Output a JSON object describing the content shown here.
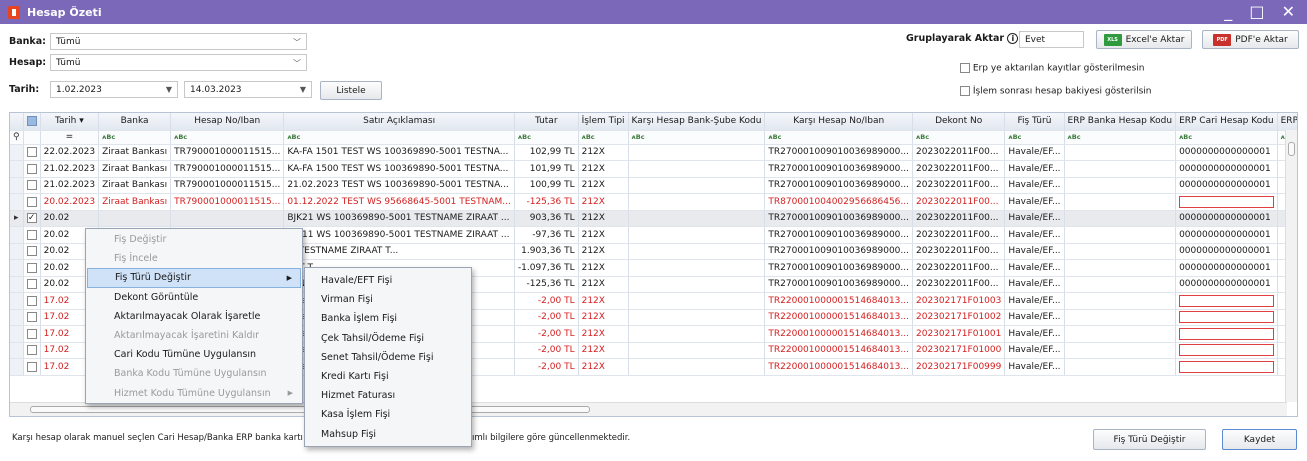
{
  "window": {
    "title": "Hesap Özeti",
    "controls": "_ □ ✕"
  },
  "filters": {
    "banka_label": "Banka:",
    "banka_value": "Tümü",
    "hesap_label": "Hesap:",
    "hesap_value": "Tümü",
    "tarih_label": "Tarih:",
    "tarih_from": "1.02.2023",
    "tarih_to": "14.03.2023",
    "list_button": "Listele"
  },
  "toolbar": {
    "group_label": "Gruplayarak Aktar",
    "info": "i",
    "group_value": "Evet",
    "excel_button": "Excel'e Aktar",
    "excel_tag": "XLS",
    "pdf_button": "PDF'e Aktar",
    "pdf_tag": "PDF"
  },
  "options": {
    "erp_hidden": "Erp ye aktarılan kayıtlar gösterilmesin",
    "balance_shown": "İşlem sonrası hesap bakiyesi gösterilsin"
  },
  "columns": [
    "",
    "Tarih",
    "Banka",
    "Hesap No/Iban",
    "Satır Açıklaması",
    "Tutar",
    "İşlem Tipi",
    "Karşı Hesap Bank-Şube Kodu",
    "Karşı Hesap No/Iban",
    "Dekont No",
    "Fiş Türü",
    "ERP Banka Hesap Kodu",
    "ERP Cari Hesap Kodu",
    "ERP"
  ],
  "filter_row": {
    "equals": "=",
    "abc": "ᴀBc"
  },
  "rows": [
    {
      "checked": false,
      "red": false,
      "sel": false,
      "date": "22.02.2023",
      "bank": "Ziraat Bankası",
      "iban": "TR790001000011515...",
      "desc": "KA-FA 1501 TEST WS 100369890-5001 TESTNA...",
      "amount": "102,99 TL",
      "type": "212X",
      "counter_branch": "",
      "counter_iban": "TR270001009010036989000...",
      "dekont": "2023022011F00...",
      "fis": "Havale/EF...",
      "erp_bank": "",
      "erp_cari": "0000000000000001"
    },
    {
      "checked": false,
      "red": false,
      "sel": false,
      "date": "21.02.2023",
      "bank": "Ziraat Bankası",
      "iban": "TR790001000011515...",
      "desc": "KA-FA 1500 TEST WS 100369890-5001 TESTNA...",
      "amount": "101,99 TL",
      "type": "212X",
      "counter_branch": "",
      "counter_iban": "TR270001009010036989000...",
      "dekont": "2023022011F00...",
      "fis": "Havale/EF...",
      "erp_bank": "",
      "erp_cari": "0000000000000001"
    },
    {
      "checked": false,
      "red": false,
      "sel": false,
      "date": "21.02.2023",
      "bank": "Ziraat Bankası",
      "iban": "TR790001000011515...",
      "desc": "21.02.2023 TEST WS 100369890-5001 TESTNA...",
      "amount": "100,99 TL",
      "type": "212X",
      "counter_branch": "",
      "counter_iban": "TR270001009010036989000...",
      "dekont": "2023022011F00...",
      "fis": "Havale/EF...",
      "erp_bank": "",
      "erp_cari": "0000000000000001"
    },
    {
      "checked": false,
      "red": true,
      "sel": false,
      "date": "20.02.2023",
      "bank": "Ziraat Bankası",
      "iban": "TR790001000011515...",
      "desc": "01.12.2022 TEST WS 95668645-5001 TESTNAM...",
      "amount": "-125,36 TL",
      "type": "212X",
      "counter_branch": "",
      "counter_iban": "TR870001004002956686456...",
      "dekont": "2023022011F00...",
      "fis": "Havale/EF...",
      "erp_bank": "",
      "erp_cari": ""
    },
    {
      "checked": true,
      "red": false,
      "sel": true,
      "date": "20.02",
      "bank": "",
      "iban": "",
      "desc": "BJK21 WS 100369890-5001 TESTNAME ZIRAAT ...",
      "amount": "903,36 TL",
      "type": "212X",
      "counter_branch": "",
      "counter_iban": "TR270001009010036989000...",
      "dekont": "2023022011F00...",
      "fis": "Havale/EF...",
      "erp_bank": "",
      "erp_cari": "0000000000000001"
    },
    {
      "checked": false,
      "red": false,
      "sel": false,
      "date": "20.02",
      "bank": "",
      "iban": "",
      "desc": "BJK11 WS 100369890-5001 TESTNAME ZIRAAT ...",
      "amount": "-97,36 TL",
      "type": "212X",
      "counter_branch": "",
      "counter_iban": "TR270001009010036989000...",
      "dekont": "2023022011F00...",
      "fis": "Havale/EF...",
      "erp_bank": "",
      "erp_cari": "0000000000000001"
    },
    {
      "checked": false,
      "red": false,
      "sel": false,
      "date": "20.02",
      "bank": "",
      "iban": "",
      "desc": "... TESTNAME ZIRAAT T...",
      "amount": "1.903,36 TL",
      "type": "212X",
      "counter_branch": "",
      "counter_iban": "TR270001009010036989000...",
      "dekont": "2023022011F00...",
      "fis": "Havale/EF...",
      "erp_bank": "",
      "erp_cari": "0000000000000001"
    },
    {
      "checked": false,
      "red": false,
      "sel": false,
      "date": "20.02",
      "bank": "",
      "iban": "",
      "desc": "AAT T...",
      "amount": "-1.097,36 TL",
      "type": "212X",
      "counter_branch": "",
      "counter_iban": "TR270001009010036989000...",
      "dekont": "2023022011F00...",
      "fis": "Havale/EF...",
      "erp_bank": "",
      "erp_cari": "0000000000000001"
    },
    {
      "checked": false,
      "red": false,
      "sel": false,
      "date": "20.02",
      "bank": "",
      "iban": "",
      "desc": "STNA...",
      "amount": "-125,36 TL",
      "type": "212X",
      "counter_branch": "",
      "counter_iban": "TR270001009010036989000...",
      "dekont": "2023022011F00...",
      "fis": "Havale/EF...",
      "erp_bank": "",
      "erp_cari": "0000000000000001"
    },
    {
      "checked": false,
      "red": true,
      "sel": false,
      "date": "17.02",
      "bank": "",
      "iban": "",
      "desc": "n para ...",
      "amount": "-2,00 TL",
      "type": "212X",
      "counter_branch": "",
      "counter_iban": "TR220001000001514684013...",
      "dekont": "202302171F01003",
      "fis": "Havale/EF...",
      "erp_bank": "",
      "erp_cari": ""
    },
    {
      "checked": false,
      "red": true,
      "sel": false,
      "date": "17.02",
      "bank": "",
      "iban": "",
      "desc": "n para ...",
      "amount": "-2,00 TL",
      "type": "212X",
      "counter_branch": "",
      "counter_iban": "TR220001000001514684013...",
      "dekont": "202302171F01002",
      "fis": "Havale/EF...",
      "erp_bank": "",
      "erp_cari": ""
    },
    {
      "checked": false,
      "red": true,
      "sel": false,
      "date": "17.02",
      "bank": "",
      "iban": "",
      "desc": "n para ...",
      "amount": "-2,00 TL",
      "type": "212X",
      "counter_branch": "",
      "counter_iban": "TR220001000001514684013...",
      "dekont": "202302171F01001",
      "fis": "Havale/EF...",
      "erp_bank": "",
      "erp_cari": ""
    },
    {
      "checked": false,
      "red": true,
      "sel": false,
      "date": "17.02",
      "bank": "",
      "iban": "",
      "desc": "n para ...",
      "amount": "-2,00 TL",
      "type": "212X",
      "counter_branch": "",
      "counter_iban": "TR220001000001514684013...",
      "dekont": "202302171F01000",
      "fis": "Havale/EF...",
      "erp_bank": "",
      "erp_cari": ""
    },
    {
      "checked": false,
      "red": true,
      "sel": false,
      "date": "17.02",
      "bank": "",
      "iban": "",
      "desc": "n para ...",
      "amount": "-2,00 TL",
      "type": "212X",
      "counter_branch": "",
      "counter_iban": "TR220001000001514684013...",
      "dekont": "202302171F00999",
      "fis": "Havale/EF...",
      "erp_bank": "",
      "erp_cari": ""
    }
  ],
  "context_menu": [
    {
      "label": "Fiş Değiştir",
      "disabled": true,
      "sub": false
    },
    {
      "label": "Fiş İncele",
      "disabled": true,
      "sub": false
    },
    {
      "label": "Fiş Türü Değiştir",
      "disabled": false,
      "sub": true,
      "hl": true
    },
    {
      "label": "Dekont Görüntüle",
      "disabled": false,
      "sub": false
    },
    {
      "label": "Aktarılmayacak Olarak İşaretle",
      "disabled": false,
      "sub": false
    },
    {
      "label": "Aktarılmayacak İşaretini Kaldır",
      "disabled": true,
      "sub": false
    },
    {
      "label": "Cari Kodu Tümüne Uygulansın",
      "disabled": false,
      "sub": false
    },
    {
      "label": "Banka Kodu Tümüne Uygulansın",
      "disabled": true,
      "sub": false
    },
    {
      "label": "Hizmet Kodu Tümüne Uygulansın",
      "disabled": true,
      "sub": true
    }
  ],
  "submenu": [
    "Havale/EFT Fişi",
    "Virman Fişi",
    "Banka İşlem Fişi",
    "Çek Tahsil/Ödeme Fişi",
    "Senet Tahsil/Ödeme Fişi",
    "Kredi Kartı Fişi",
    "Hizmet Faturası",
    "Kasa İşlem Fişi",
    "Mahsup Fişi"
  ],
  "footer": {
    "status_left": "Karşı hesap olarak manuel seçlen Cari Hesap/Banka ERP banka kartı",
    "status_right": "ımlı bilgilere göre güncellenmektedir.",
    "fis_button": "Fiş Türü Değiştir",
    "save_button": "Kaydet"
  }
}
